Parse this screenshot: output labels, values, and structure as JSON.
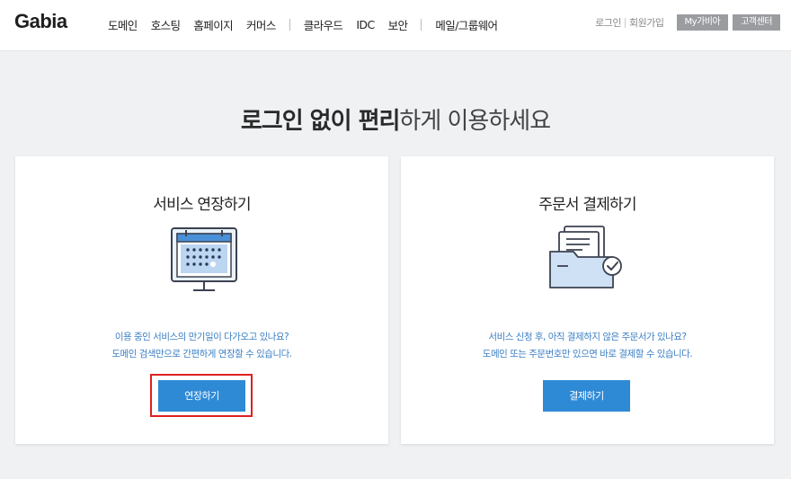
{
  "header": {
    "logo": "Gabia",
    "nav": [
      "도메인",
      "호스팅",
      "홈페이지",
      "커머스",
      "클라우드",
      "IDC",
      "보안",
      "메일/그룹웨어"
    ],
    "login": "로그인",
    "signup": "회원가입",
    "my_gabia": "My가비아",
    "support": "고객센터"
  },
  "main": {
    "title_strong": "로그인 없이 편리",
    "title_light": "하게 이용하세요"
  },
  "cards": [
    {
      "title": "서비스 연장하기",
      "icon": "calendar-monitor-icon",
      "desc_line1": "이용 중인 서비스의 만기일이 다가오고 있나요?",
      "desc_line2": "도메인 검색만으로 간편하게 연장할 수 있습니다.",
      "button": "연장하기"
    },
    {
      "title": "주문서 결제하기",
      "icon": "folder-check-icon",
      "desc_line1": "서비스 신청 후, 아직 결제하지 않은 주문서가 있나요?",
      "desc_line2": "도메인 또는 주문번호만 있으면 바로 결제할 수 있습니다.",
      "button": "결제하기"
    }
  ],
  "colors": {
    "accent": "#2f8ad6",
    "desc_text": "#3b7fc4",
    "highlight": "#e02020",
    "background": "#eff1f3"
  }
}
